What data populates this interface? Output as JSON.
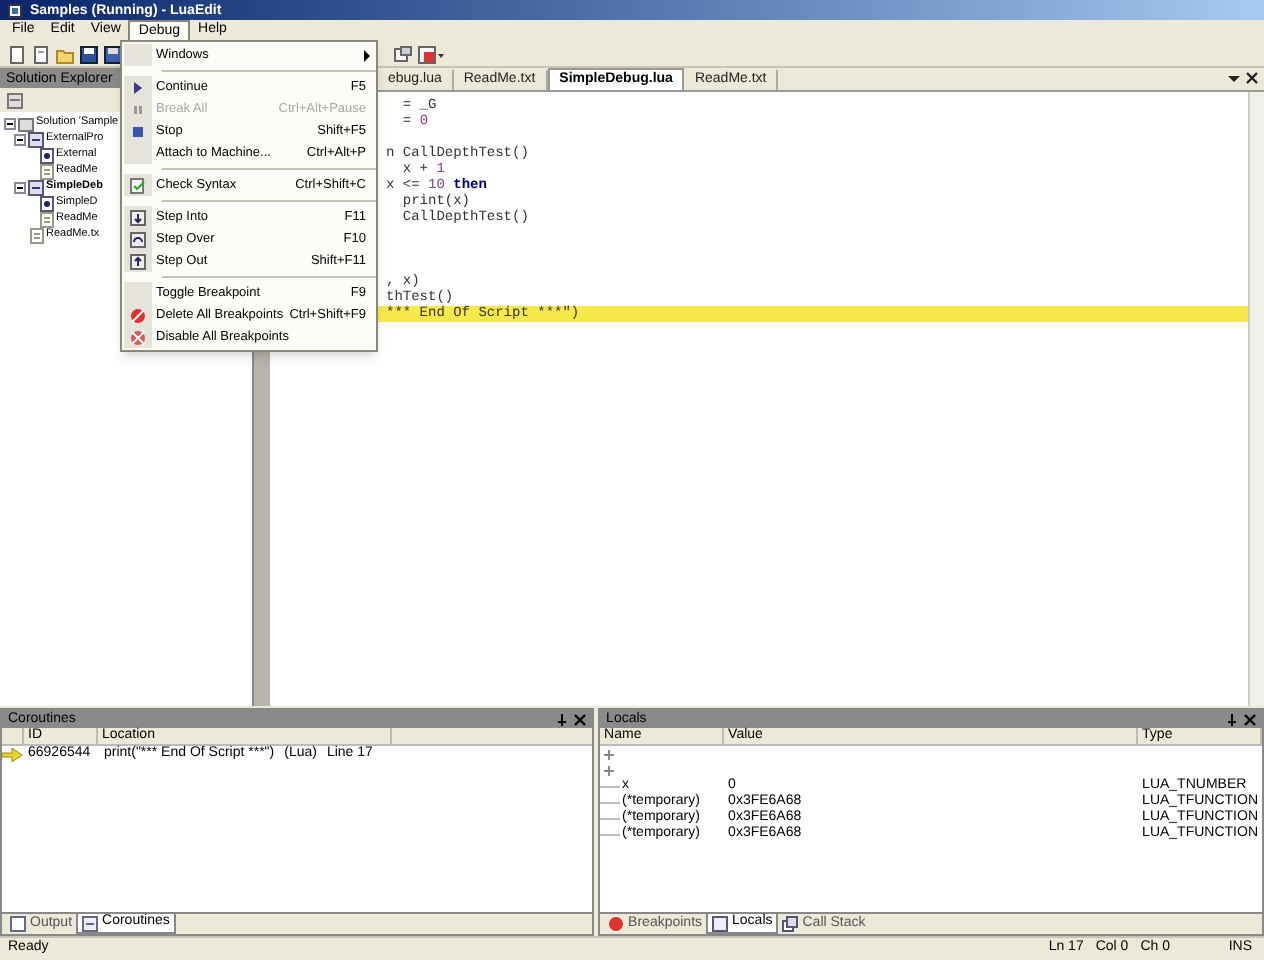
{
  "window": {
    "title": "Samples (Running) - LuaEdit"
  },
  "menu_bar": [
    {
      "label": "File",
      "selected": false
    },
    {
      "label": "Edit",
      "selected": false
    },
    {
      "label": "View",
      "selected": false
    },
    {
      "label": "Debug",
      "selected": true
    },
    {
      "label": "Help",
      "selected": false
    }
  ],
  "debug_menu": [
    {
      "kind": "submenu",
      "label": "Windows"
    },
    {
      "kind": "separator"
    },
    {
      "kind": "item",
      "label": "Continue",
      "shortcut": "F5",
      "disabled": false
    },
    {
      "kind": "item",
      "label": "Break All",
      "shortcut": "Ctrl+Alt+Pause",
      "disabled": true
    },
    {
      "kind": "item",
      "label": "Stop",
      "shortcut": "Shift+F5",
      "disabled": false
    },
    {
      "kind": "item",
      "label": "Attach to Machine...",
      "shortcut": "Ctrl+Alt+P",
      "disabled": false
    },
    {
      "kind": "separator"
    },
    {
      "kind": "item",
      "label": "Check Syntax",
      "shortcut": "Ctrl+Shift+C",
      "disabled": false
    },
    {
      "kind": "separator"
    },
    {
      "kind": "item",
      "label": "Step Into",
      "shortcut": "F11",
      "disabled": false
    },
    {
      "kind": "item",
      "label": "Step Over",
      "shortcut": "F10",
      "disabled": false
    },
    {
      "kind": "item",
      "label": "Step Out",
      "shortcut": "Shift+F11",
      "disabled": false
    },
    {
      "kind": "separator"
    },
    {
      "kind": "item",
      "label": "Toggle Breakpoint",
      "shortcut": "F9",
      "disabled": false
    },
    {
      "kind": "item",
      "label": "Delete All Breakpoints",
      "shortcut": "Ctrl+Shift+F9",
      "disabled": false
    },
    {
      "kind": "item",
      "label": "Disable All Breakpoints",
      "disabled": false
    }
  ],
  "solution_explorer": {
    "title": "Solution Explorer",
    "tree": [
      {
        "label": "Solution 'Sample",
        "kind": "solution",
        "bold": false,
        "expanded": true,
        "children": [
          {
            "label": "ExternalPro",
            "kind": "project",
            "bold": false,
            "expanded": true,
            "children": [
              {
                "label": "External",
                "kind": "lua",
                "bold": false
              },
              {
                "label": "ReadMe",
                "kind": "text",
                "bold": false
              }
            ]
          },
          {
            "label": "SimpleDeb",
            "kind": "project",
            "bold": true,
            "expanded": true,
            "children": [
              {
                "label": "SimpleD",
                "kind": "lua",
                "bold": false
              },
              {
                "label": "ReadMe",
                "kind": "text",
                "bold": false
              }
            ]
          },
          {
            "label": "ReadMe.tx",
            "kind": "text",
            "bold": false
          }
        ]
      }
    ]
  },
  "editor": {
    "tabs": [
      {
        "label": "ebug.lua",
        "selected": false
      },
      {
        "label": "ReadMe.txt",
        "selected": false
      },
      {
        "label": "SimpleDebug.lua",
        "selected": true
      },
      {
        "label": "ReadMe.txt",
        "selected": false
      }
    ],
    "lines": [
      {
        "current": false,
        "parts": [
          {
            "text": "  = _G",
            "kind": "plain"
          }
        ]
      },
      {
        "current": false,
        "parts": [
          {
            "text": "  = ",
            "kind": "plain"
          },
          {
            "text": "0",
            "kind": "number"
          }
        ]
      },
      {
        "current": false
      },
      {
        "current": false,
        "parts": [
          {
            "text": "n CallDepthTest()",
            "kind": "plain"
          }
        ]
      },
      {
        "current": false,
        "parts": [
          {
            "text": "  x + ",
            "kind": "plain"
          },
          {
            "text": "1",
            "kind": "number"
          }
        ]
      },
      {
        "current": false,
        "parts": [
          {
            "text": "x <= ",
            "kind": "plain"
          },
          {
            "text": "10",
            "kind": "number"
          },
          {
            "text": " then",
            "kind": "keyword"
          }
        ]
      },
      {
        "current": false,
        "parts": [
          {
            "text": "  print(x)",
            "kind": "plain"
          }
        ]
      },
      {
        "current": false,
        "parts": [
          {
            "text": "  CallDepthTest()",
            "kind": "plain"
          }
        ]
      },
      {
        "current": false
      },
      {
        "current": false
      },
      {
        "current": false
      },
      {
        "current": false,
        "parts": [
          {
            "text": ", x)",
            "kind": "plain"
          }
        ]
      },
      {
        "current": false,
        "parts": [
          {
            "text": "thTest()",
            "kind": "plain"
          }
        ]
      },
      {
        "current": true,
        "parts": [
          {
            "text": "*** End Of Script ***\")",
            "kind": "plain"
          }
        ]
      }
    ]
  },
  "coroutines": {
    "title": "Coroutines",
    "columns": [
      "ID",
      "Location"
    ],
    "rows": [
      {
        "current": true,
        "id": "66926544",
        "location": "print(\"*** End Of Script ***\")",
        "language": "(Lua)",
        "line": "Line 17"
      }
    ],
    "tabs": [
      {
        "label": "Output",
        "selected": false
      },
      {
        "label": "Coroutines",
        "selected": true
      }
    ]
  },
  "locals": {
    "title": "Locals",
    "columns": [
      "Name",
      "Value",
      "Type"
    ],
    "rows": [
      {
        "kind": "collapsed"
      },
      {
        "kind": "collapsed"
      },
      {
        "kind": "variable",
        "name": "x",
        "value": "0",
        "type": "LUA_TNUMBER"
      },
      {
        "kind": "variable",
        "name": "(*temporary)",
        "value": "0x3FE6A68",
        "type": "LUA_TFUNCTION"
      },
      {
        "kind": "variable",
        "name": "(*temporary)",
        "value": "0x3FE6A68",
        "type": "LUA_TFUNCTION"
      },
      {
        "kind": "variable",
        "name": "(*temporary)",
        "value": "0x3FE6A68",
        "type": "LUA_TFUNCTION"
      }
    ],
    "tabs": [
      {
        "label": "Breakpoints",
        "selected": false
      },
      {
        "label": "Locals",
        "selected": true
      },
      {
        "label": "Call Stack",
        "selected": false
      }
    ]
  },
  "status_bar": {
    "text": "Ready",
    "line": "Ln 17",
    "column": "Col 0",
    "char": "Ch 0",
    "mode": "INS"
  }
}
